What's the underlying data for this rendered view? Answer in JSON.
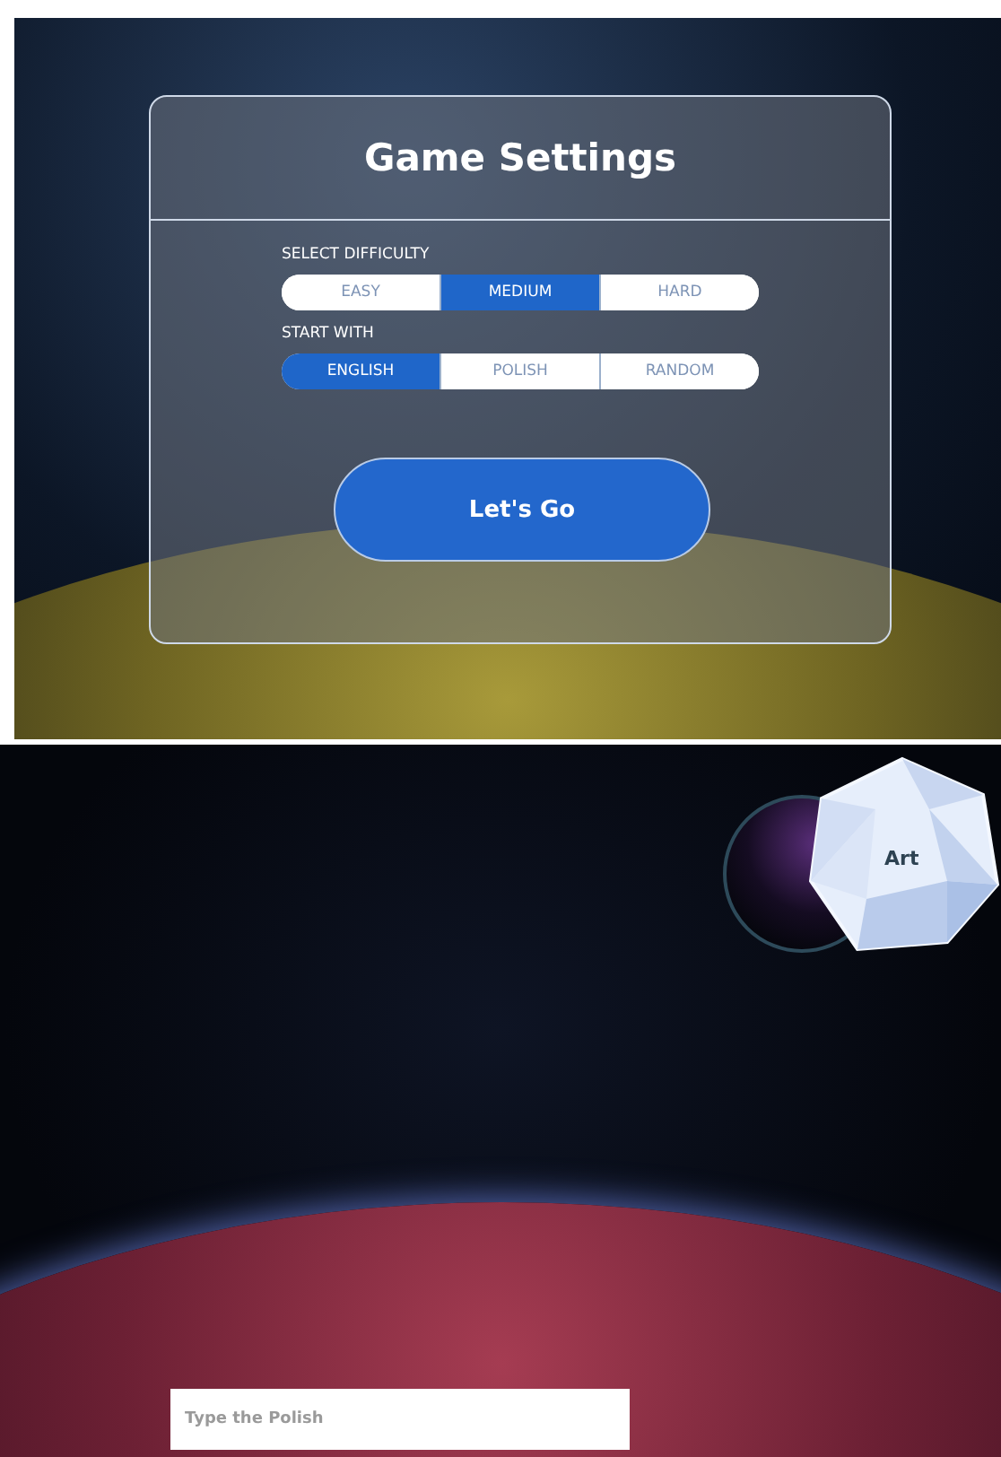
{
  "settings_screen": {
    "title": "Game Settings",
    "groups": [
      {
        "label": "SELECT DIFFICULTY",
        "options": [
          {
            "label": "EASY",
            "selected": false
          },
          {
            "label": "MEDIUM",
            "selected": true
          },
          {
            "label": "HARD",
            "selected": false
          }
        ]
      },
      {
        "label": "START WITH",
        "options": [
          {
            "label": "ENGLISH",
            "selected": true
          },
          {
            "label": "POLISH",
            "selected": false
          },
          {
            "label": "RANDOM",
            "selected": false
          }
        ]
      }
    ],
    "start_button": "Let's Go"
  },
  "game_screen": {
    "category": "Art",
    "answer": {
      "placeholder": "Type the Polish"
    }
  }
}
